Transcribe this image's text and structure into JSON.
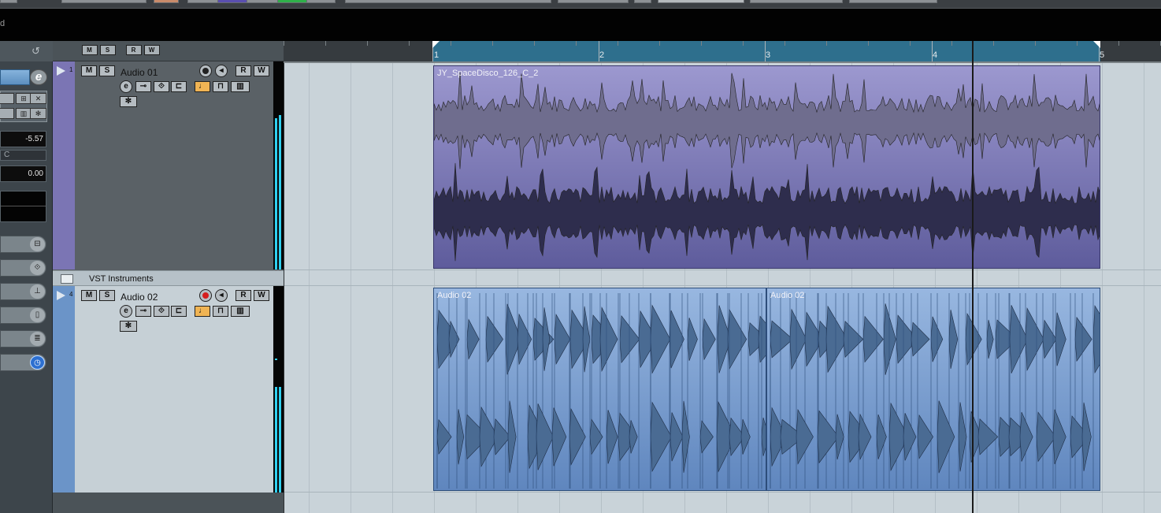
{
  "topbar": {
    "status_text": "d"
  },
  "inspector": {
    "volume": "-5.57",
    "pan_label": "C",
    "pan_value": "0.00"
  },
  "toolbar": {
    "m_label": "M",
    "s_label": "S",
    "r_label": "R",
    "w_label": "W"
  },
  "ruler": {
    "bars": [
      "1",
      "2",
      "3",
      "4",
      "5"
    ]
  },
  "tracks": [
    {
      "number": "1",
      "name": "Audio 01",
      "mute": "M",
      "solo": "S",
      "read": "R",
      "write": "W",
      "edit": "e",
      "record_armed": false,
      "color": "#7b75b4"
    },
    {
      "name": "VST Instruments",
      "type": "folder"
    },
    {
      "number": "4",
      "name": "Audio 02",
      "mute": "M",
      "solo": "S",
      "read": "R",
      "write": "W",
      "edit": "e",
      "record_armed": true,
      "color": "#6b94c8"
    }
  ],
  "events": [
    {
      "name": "JY_SpaceDisco_126_C_2",
      "track": "Audio 01"
    },
    {
      "name": "Audio 02",
      "track": "Audio 02"
    },
    {
      "name": "Audio 02",
      "track": "Audio 02"
    }
  ]
}
